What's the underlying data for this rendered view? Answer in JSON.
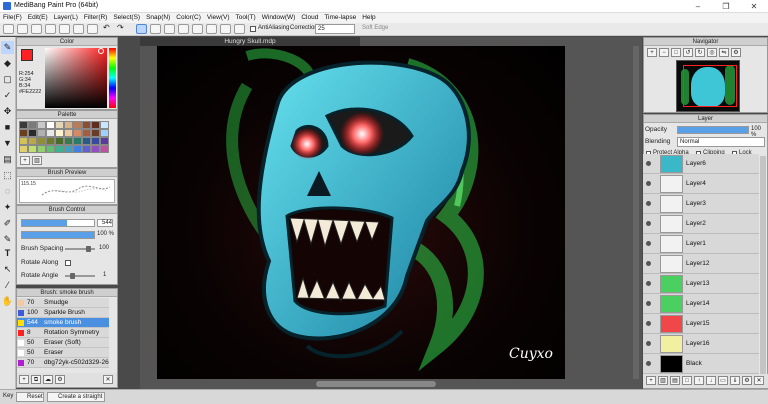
{
  "window": {
    "title": "MediBang Paint Pro (64bit)",
    "minimize": "–",
    "maximize": "❐",
    "close": "✕"
  },
  "menu": [
    "File(F)",
    "Edit(E)",
    "Layer(L)",
    "Filter(R)",
    "Select(S)",
    "Snap(N)",
    "Color(C)",
    "View(V)",
    "Tool(T)",
    "Window(W)",
    "Cloud",
    "Time-lapse",
    "Help"
  ],
  "toolbar": {
    "antialiasing_label": "AntiAliasing",
    "correction_label": "Correction",
    "correction_value": "25",
    "soft_edge_label": "Soft Edge"
  },
  "document": {
    "title": "Hungry Skull.mdp",
    "signature": "Cuyxo"
  },
  "color_panel": {
    "title": "Color",
    "r": "R:254",
    "g": "G:34",
    "b": "B:34",
    "hex": "#FE2222",
    "primary": "#fe2222",
    "secondary": "#ffffff"
  },
  "palette_panel": {
    "title": "Palette",
    "colors": [
      "#3a3a3a",
      "#7a7a7a",
      "#c9c9c9",
      "#ffffff",
      "#e3d7b8",
      "#d9b38c",
      "#b77c5a",
      "#8a4f35",
      "#5e2f1f",
      "#c8e6ff",
      "#6a3f20",
      "#2a2a2a",
      "#b0b0b0",
      "#e8e8e8",
      "#fdf3d0",
      "#f0c8a0",
      "#d58a66",
      "#a65c3f",
      "#6b3a28",
      "#9fd0ff",
      "#d4c15a",
      "#b8a84a",
      "#8f8f3a",
      "#6c7a2a",
      "#4a6a2a",
      "#3a7a4a",
      "#2a7a6a",
      "#2a5a8a",
      "#3a4a9a",
      "#5a3a9a",
      "#e0d070",
      "#c0e070",
      "#90d070",
      "#60c070",
      "#40b090",
      "#40a0c0",
      "#4080e0",
      "#6060d0",
      "#9050c0",
      "#c050a0"
    ]
  },
  "brush_preview": {
    "title": "Brush Preview",
    "size_label": "115.15"
  },
  "brush_control": {
    "title": "Brush Control",
    "size_value": "544",
    "opacity_value": "100 %",
    "size_level": 0.62,
    "opacity_level": 1.0,
    "spacing_label": "Brush Spacing",
    "spacing_value": "100",
    "spacing_level": 0.85,
    "rotate_along_label": "Rotate Along",
    "rotate_angle_label": "Rotate Angle",
    "rotate_angle_value": "1",
    "rotate_angle_level": 0.2
  },
  "brush_list": {
    "title": "Brush: smoke brush",
    "items": [
      {
        "num": "70",
        "label": "Smudge",
        "color": "#f2c9a0"
      },
      {
        "num": "100",
        "label": "Sparkle Brush",
        "color": "#3b5bd9"
      },
      {
        "num": "544",
        "label": "smoke brush",
        "color": "#ffe000"
      },
      {
        "num": "8",
        "label": "Rotation Symmetry Pen",
        "color": "#ff2020"
      },
      {
        "num": "50",
        "label": "Eraser (Soft)",
        "color": "#ffffff"
      },
      {
        "num": "50",
        "label": "Eraser",
        "color": "#ffffff"
      },
      {
        "num": "70",
        "label": "dbg72yk-c502d329-26",
        "color": "#b020d0"
      }
    ]
  },
  "navigator": {
    "title": "Navigator"
  },
  "layer_panel": {
    "title": "Layer",
    "opacity_label": "Opacity",
    "opacity_value": "100 %",
    "opacity_level": 1.0,
    "blending_label": "Blending",
    "blending_value": "Normal",
    "protect_alpha": "Protect Alpha",
    "clipping": "Clipping",
    "lock": "Lock",
    "layers": [
      {
        "name": "Layer6",
        "thumb": "#3ab8c8"
      },
      {
        "name": "Layer4",
        "thumb": "#f2f2f2"
      },
      {
        "name": "Layer3",
        "thumb": "#f2f2f2"
      },
      {
        "name": "Layer2",
        "thumb": "#f2f2f2"
      },
      {
        "name": "Layer1",
        "thumb": "#f2f2f2"
      },
      {
        "name": "Layer12",
        "thumb": "#f2f2f2"
      },
      {
        "name": "Layer13",
        "thumb": "#4ad060"
      },
      {
        "name": "Layer14",
        "thumb": "#4ad060"
      },
      {
        "name": "Layer15",
        "thumb": "#f04848"
      },
      {
        "name": "Layer16",
        "thumb": "#f0f0a0"
      },
      {
        "name": "Black",
        "thumb": "#000000"
      }
    ]
  },
  "status": {
    "key_label": "Key",
    "reset_label": "Reset",
    "straight_line_label": "Create a straight line"
  },
  "colors": {
    "accent": "#4b8fe0",
    "skull": "#3fc6d6",
    "smoke": "#2fd04a"
  }
}
